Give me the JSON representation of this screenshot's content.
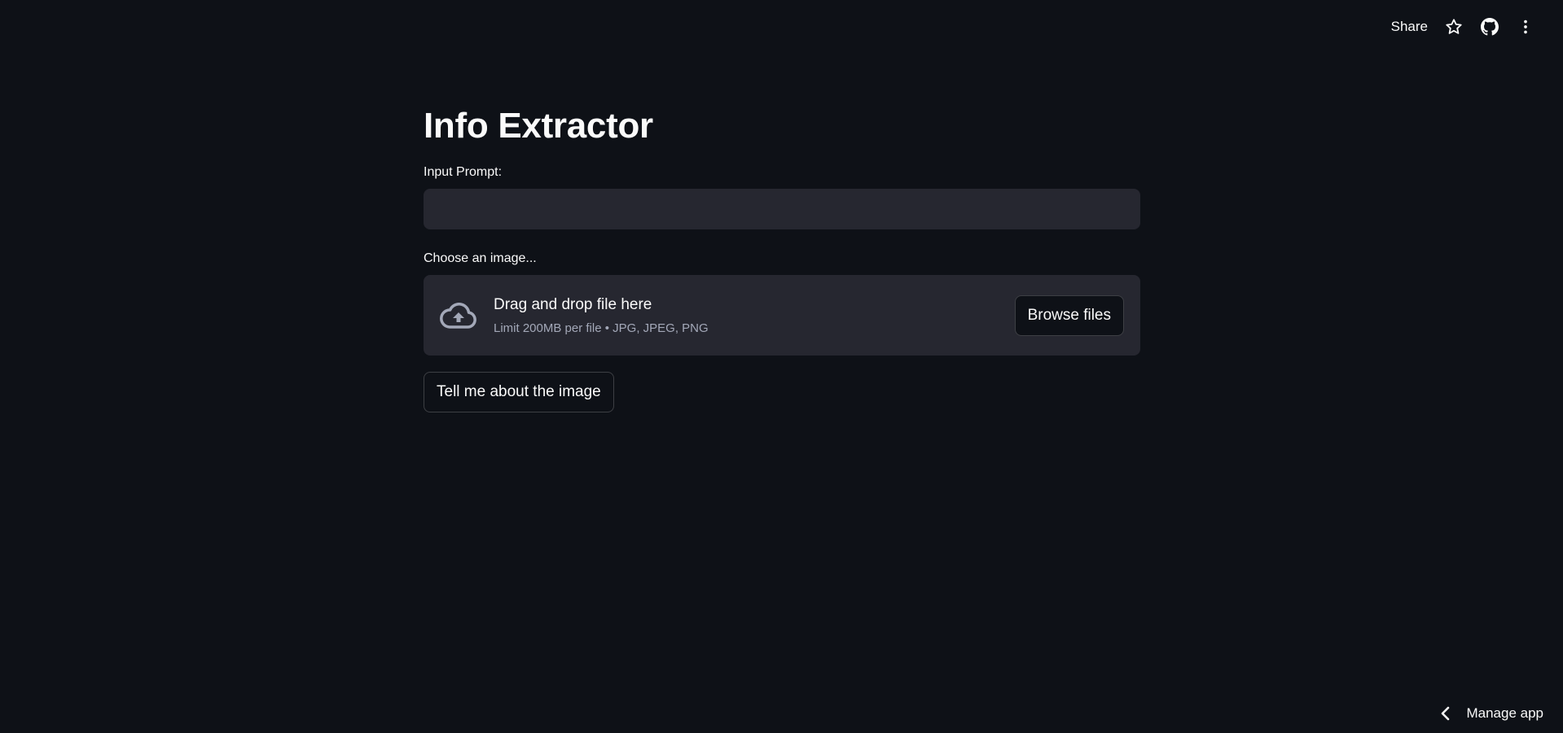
{
  "toolbar": {
    "share_label": "Share",
    "icons": [
      "star-icon",
      "github-icon",
      "kebab-menu-icon"
    ]
  },
  "main": {
    "title": "Info Extractor",
    "prompt_label": "Input Prompt:",
    "prompt_value": "",
    "prompt_placeholder": "",
    "image_label": "Choose an image...",
    "dropzone": {
      "icon": "cloud-upload-icon",
      "main_text": "Drag and drop file here",
      "sub_text": "Limit 200MB per file • JPG, JPEG, PNG",
      "browse_label": "Browse files"
    },
    "submit_label": "Tell me about the image"
  },
  "footer": {
    "manage_label": "Manage app",
    "icon": "chevron-left-icon"
  },
  "colors": {
    "background": "#0e1117",
    "surface": "#262730",
    "text": "#fafafa",
    "muted_text": "#a3a8b8"
  }
}
